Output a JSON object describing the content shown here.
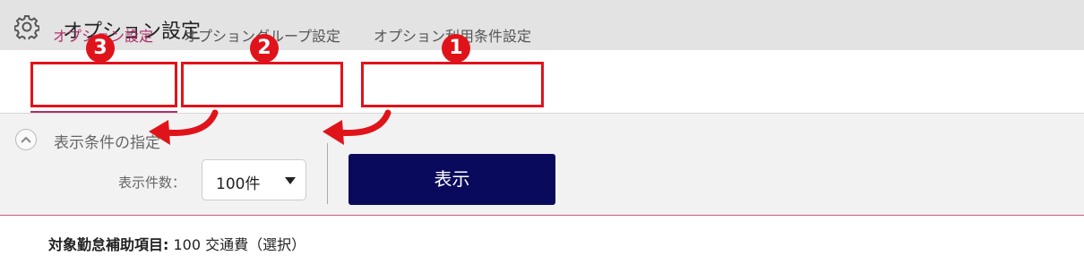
{
  "header": {
    "title": "オプション設定",
    "icon": "gear-icon"
  },
  "tabs": [
    {
      "label": "オプション設定",
      "active": true
    },
    {
      "label": "オプショングループ設定",
      "active": false
    },
    {
      "label": "オプション利用条件設定",
      "active": false
    }
  ],
  "annotations": {
    "badges": [
      "3",
      "2",
      "1"
    ],
    "color": "#e1131a"
  },
  "conditions": {
    "title": "表示条件の指定",
    "count_label": "表示件数：",
    "count_value": "100件",
    "show_button": "表示"
  },
  "target": {
    "label": "対象勤怠補助項目:",
    "value": "100 交通費（選択）"
  },
  "colors": {
    "accent": "#b0306a",
    "button": "#0a0a5c",
    "header_bg": "#e3e3e3"
  }
}
